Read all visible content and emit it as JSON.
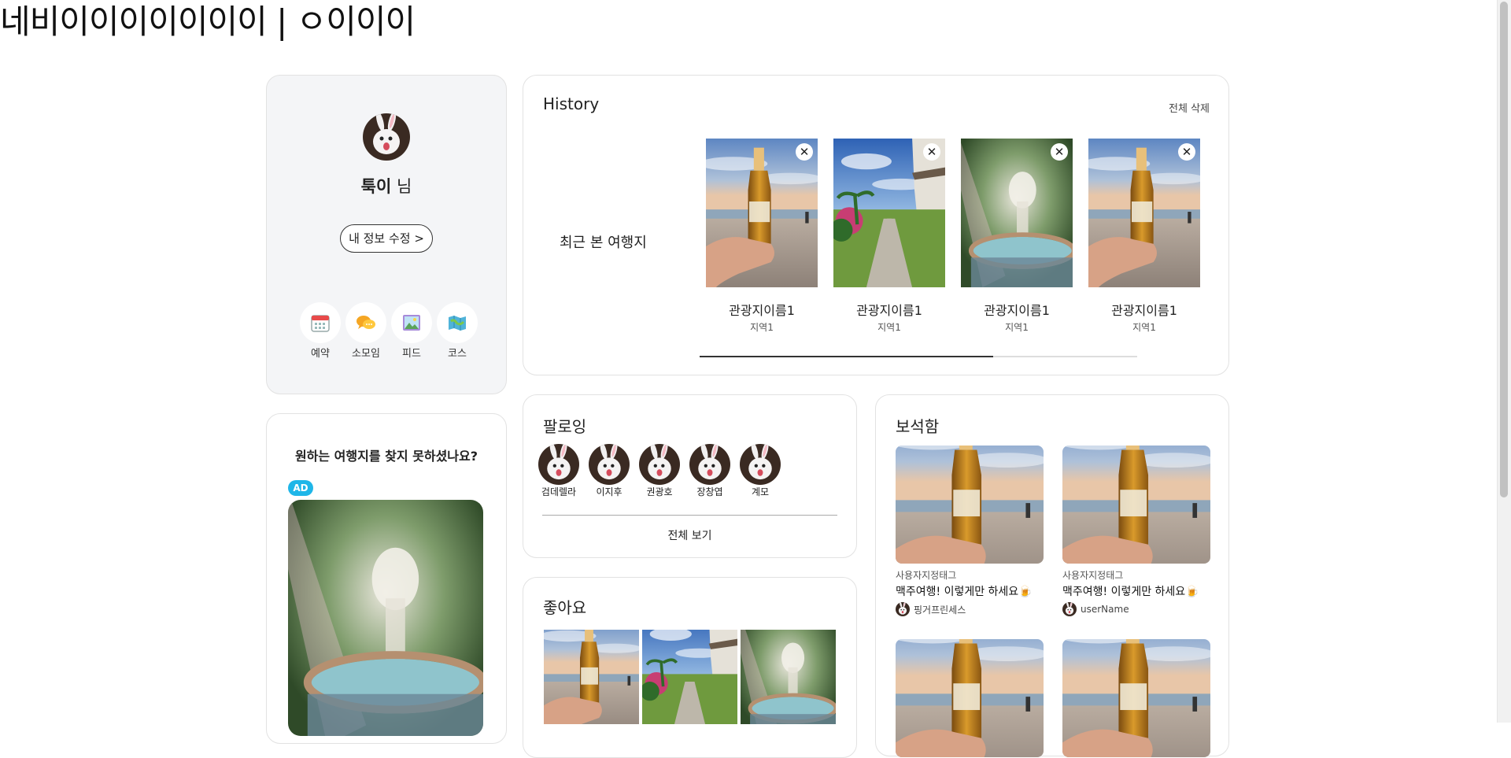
{
  "site": {
    "title": "네비이이이이이이이 | ㅇ이이이"
  },
  "profile": {
    "name": "툭이",
    "suffix": "님",
    "edit_button": "내 정보 수정 >",
    "quick_links": [
      {
        "label": "예약",
        "icon": "calendar-icon"
      },
      {
        "label": "소모임",
        "icon": "chat-bubble-icon"
      },
      {
        "label": "피드",
        "icon": "picture-icon"
      },
      {
        "label": "코스",
        "icon": "map-icon"
      }
    ]
  },
  "ad": {
    "text": "원하는 여행지를 찾지 못하셨나요?",
    "badge": "AD"
  },
  "history": {
    "title": "History",
    "clear_all": "전체 삭제",
    "label": "최근 본 여행지",
    "items": [
      {
        "name": "관광지이름1",
        "region": "지역1",
        "image": "beer-beach"
      },
      {
        "name": "관광지이름1",
        "region": "지역1",
        "image": "garden-path"
      },
      {
        "name": "관광지이름1",
        "region": "지역1",
        "image": "fountain"
      },
      {
        "name": "관광지이름1",
        "region": "지역1",
        "image": "beer-beach"
      }
    ],
    "scroll_fraction": 0.67
  },
  "following": {
    "title": "팔로잉",
    "users": [
      "검데렐라",
      "이지후",
      "권광호",
      "장창엽",
      "계모"
    ],
    "see_all": "전체 보기"
  },
  "likes": {
    "title": "좋아요",
    "images": [
      "beer-beach",
      "garden-path",
      "fountain"
    ]
  },
  "jewel_box": {
    "title": "보석함",
    "posts": [
      {
        "tag": "사용자지정태그",
        "title": "맥주여행! 이렇게만 하세요🍺",
        "user": "핑거프린세스"
      },
      {
        "tag": "사용자지정태그",
        "title": "맥주여행! 이렇게만 하세요🍺",
        "user": "userName"
      },
      {
        "tag": "",
        "title": "",
        "user": ""
      },
      {
        "tag": "",
        "title": "",
        "user": ""
      }
    ]
  },
  "colors": {
    "ad_badge": "#1fb6e8",
    "card_border": "#e2e2e2",
    "profile_bg": "#f4f5f7"
  }
}
